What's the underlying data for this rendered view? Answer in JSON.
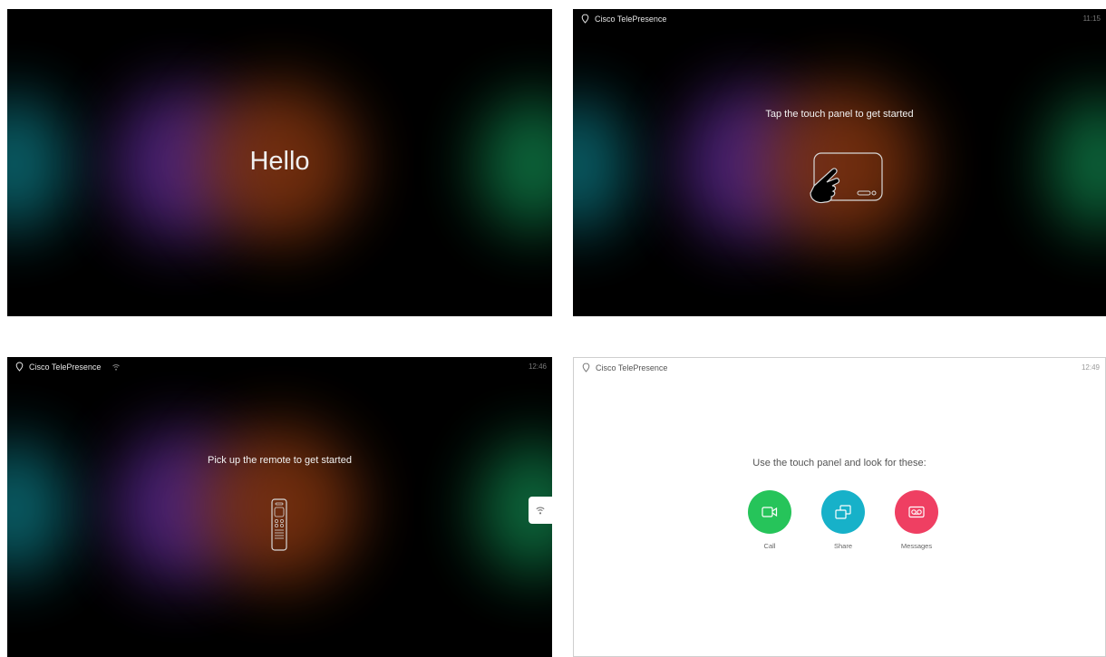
{
  "panel1": {
    "greeting": "Hello"
  },
  "panel2": {
    "brand": "Cisco TelePresence",
    "time": "11:15",
    "message": "Tap the touch panel to get started"
  },
  "panel3": {
    "brand": "Cisco TelePresence",
    "time": "12:46",
    "message": "Pick up the remote to get started"
  },
  "panel4": {
    "brand": "Cisco TelePresence",
    "time": "12:49",
    "message": "Use the touch panel and look for these:",
    "items": [
      {
        "label": "Call",
        "color": "#26c45a",
        "icon": "video-camera-icon"
      },
      {
        "label": "Share",
        "color": "#17b1c9",
        "icon": "share-screens-icon"
      },
      {
        "label": "Messages",
        "color": "#ef3f62",
        "icon": "voicemail-icon"
      }
    ]
  },
  "colors": {
    "glow_teal": "#0b6e79",
    "glow_purple": "#5b2a8a",
    "glow_orange": "#8a3a12",
    "glow_green": "#0f7a4a"
  }
}
